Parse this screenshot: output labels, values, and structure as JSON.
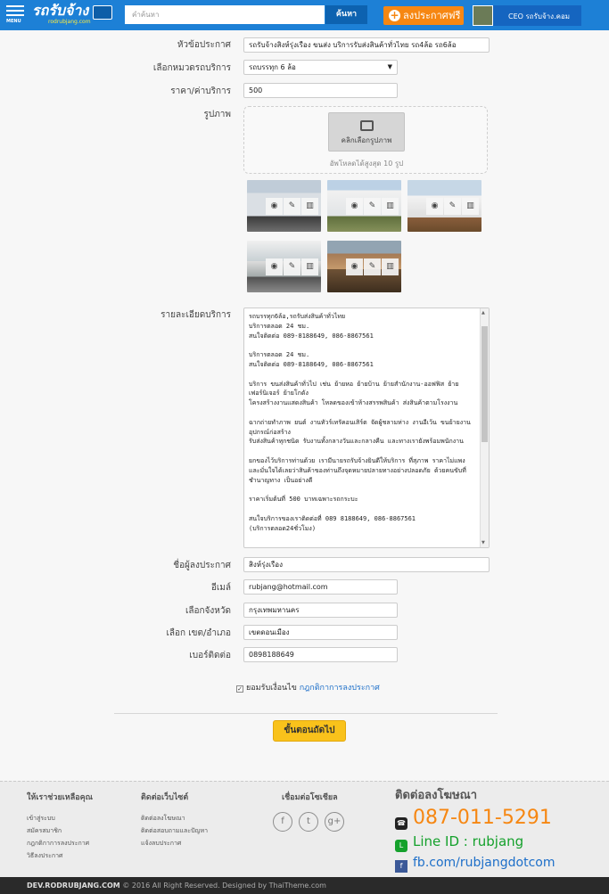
{
  "header": {
    "menu_label": "MENU",
    "logo_text": "รถรับจ้าง",
    "logo_sub": "rodrubjang.com",
    "search_placeholder": "คำค้นหา",
    "search_button": "ค้นหา",
    "post_button": "ลงประกาศฟรี",
    "user_name": "CEO รถรับจ้าง.คอม"
  },
  "form": {
    "title_label": "หัวข้อประกาศ",
    "title_value": "รถรับจ้างสิงห์รุ่งเรือง ขนส่ง บริการรับส่งสินค้าทั่วไทย รถ4ล้อ รถ6ล้อ",
    "category_label": "เลือกหมวดรถบริการ",
    "category_value": "รถบรรทุก 6 ล้อ",
    "price_label": "ราคา/ค่าบริการ",
    "price_value": "500",
    "image_label": "รูปภาพ",
    "pick_button": "คลิกเลือกรูปภาพ",
    "upload_hint": "อัพโหลดได้สูงสุด 10 รูป",
    "detail_label": "รายละเอียดบริการ",
    "detail_text": "รถบรรทุก6ล้อ,รถรับส่งสินค้าทั่วไทย\nบริการตลอด 24 ชม.\nสนใจติดต่อ 089-8188649, 086-8867561\n\nบริการตลอด 24 ชม.\nสนใจติดต่อ 089-8188649, 086-8867561\n\nบริการ ขนส่งสินค้าทั่วไป เช่น ย้ายหอ ย้ายบ้าน ย้ายสำนักงาน-ออฟฟิส ย้ายเฟอร์นิเจอร์ ย้ายโกดัง\nโครงสร้างงานแสดงสินค้า โหลดของเข้าห้างสรรพสินค้า ส่งสินค้าตามโรงงาน\n\nฉากถ่ายทำภาพ ยนต์ งานทัวร์เทรัคอนเสิร์ต จัดผู้ชลามห่าง งานอีเว้น ขนย้ายงานอุปกรณ์ก่อสร้าง\nรับส่งสินค้าทุกชนิด รับงานทั้งกลางวันและกลางคืน และทางเรายังพร้อมพนักงาน\n\nยกของไว้บริการท่านด้วย เรามีนายรถรับจ้างยินดีให้บริการ ที่สุภาพ ราคาไม่แพง และมั่นใจได้เลยว่าสินค้าของท่านถึงจุดหมายปลายทางอย่างปลอดภัย ด้วยคนขับที่ชำนาญทาง เป็นอย่างดี\n\nราคาเริ่มต้นที่ 500 บาทเฉพาะรถกระบะ\n\nสนใจบริการของเราติดต่อที่ 089 8188649, 086-8867561\n(บริการตลอด24ชั่วโมง)",
    "poster_label": "ชื่อผู้ลงประกาศ",
    "poster_value": "สิงห์รุ่งเรือง",
    "email_label": "อีเมล์",
    "email_value": "rubjang@hotmail.com",
    "province_label": "เลือกจังหวัด",
    "province_value": "กรุงเทพมหานคร",
    "district_label": "เลือก เขต/อำเภอ",
    "district_value": "เขตดอนเมือง",
    "phone_label": "เบอร์ติดต่อ",
    "phone_value": "0898188649",
    "agree_text": "ยอมรับเงื่อนไข",
    "rules_link": "กฎกติกาการลงประกาศ",
    "next_button": "ขั้นตอนถัดไป"
  },
  "footer": {
    "help_title": "ให้เราช่วยเหลือคุณ",
    "help_links": [
      "เข้าสู่ระบบ",
      "สมัครสมาชิก",
      "กฎกติกาการลงประกาศ",
      "วิธีลงประกาศ"
    ],
    "contact_title": "ติดต่อเว็บไซต์",
    "contact_links": [
      "ติดต่อลงโฆษณา",
      "ติดต่อสอบถามและปัญหา",
      "แจ้งลบประกาศ"
    ],
    "social_title": "เชื่อมต่อโซเชียล",
    "ads_title": "ติดต่อลงโฆษณา",
    "ads_phone": "087-011-5291",
    "ads_line": "Line ID : rubjang",
    "ads_fb": "fb.com/rubjangdotcom",
    "site": "DEV.RODRUBJANG.COM",
    "copyright": "© 2016 All Right Reserved. Designed by ThaiTheme.com"
  },
  "colors": {
    "brand": "#1d80d6",
    "accent": "#f68712",
    "button": "#f9c21b",
    "line": "#15a12c",
    "link": "#1d6fc9"
  }
}
